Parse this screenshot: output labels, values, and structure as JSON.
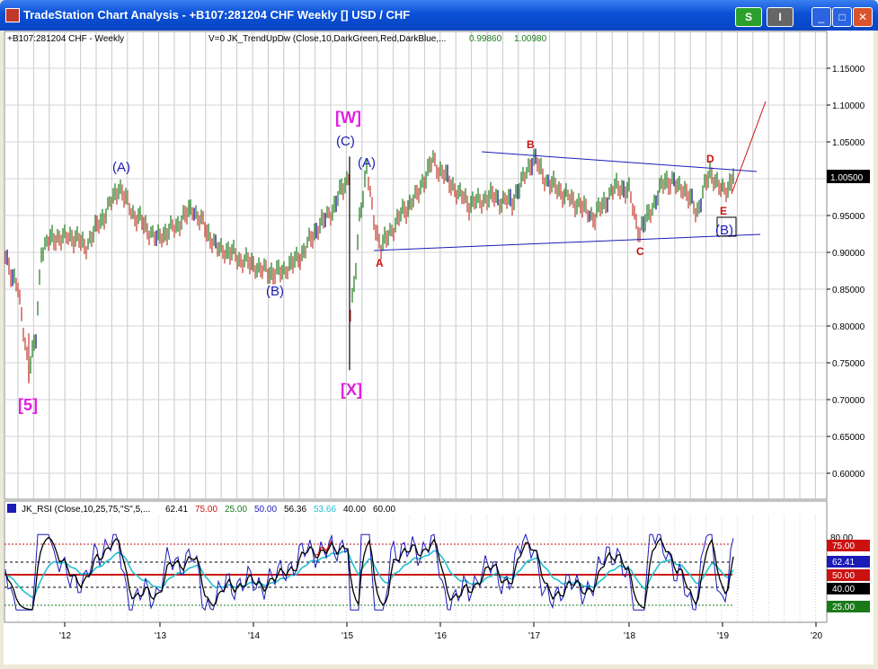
{
  "window": {
    "title": "TradeStation Chart Analysis - +B107:281204 CHF Weekly [] USD / CHF",
    "s_button": "S",
    "i_button": "I",
    "minimize": "_",
    "maximize": "□",
    "close": "✕"
  },
  "price_pane": {
    "symbol_label": "+B107:281204 CHF - Weekly",
    "indicator_label": "V=0   JK_TrendUpDw (Close,10,DarkGreen,Red,DarkBlue,...",
    "indicator_val1": "0.99860",
    "indicator_val2": "1.00980",
    "current_price": "1.00500",
    "y_ticks": [
      "1.15000",
      "1.10000",
      "1.05000",
      "1.00000",
      "0.95000",
      "0.90000",
      "0.85000",
      "0.80000",
      "0.75000",
      "0.70000",
      "0.65000",
      "0.60000"
    ],
    "wave_labels": {
      "five": "[5]",
      "w": "[W]",
      "x": "[X]",
      "a1": "(A)",
      "b1": "(B)",
      "c1": "(C)",
      "a2": "(A)",
      "b2": "(B)",
      "small_a": "A",
      "small_b": "B",
      "small_c": "C",
      "small_d": "D",
      "small_e": "E"
    }
  },
  "rsi_pane": {
    "label": "JK_RSI (Close,10,25,75,\"S\",5,...",
    "v1": "62.41",
    "v2": "75.00",
    "v3": "25.00",
    "v4": "50.00",
    "v5": "56.36",
    "v6": "53.66",
    "v7": "40.00",
    "v8": "60.00",
    "y_ticks": [
      "80.00"
    ],
    "right_boxes": {
      "b75": "75.00",
      "b62": "62.41",
      "b50": "50.00",
      "b40": "40.00",
      "b25": "25.00"
    }
  },
  "x_axis": {
    "ticks": [
      "'12",
      "'13",
      "'14",
      "'15",
      "'16",
      "'17",
      "'18",
      "'19",
      "'20"
    ]
  },
  "colors": {
    "up_bar": "#1a7a1a",
    "down_bar": "#c0392b",
    "neutral_bar": "#000080",
    "blue_label": "#1b1bb8",
    "magenta_label": "#e020e0",
    "red_label": "#cc1111"
  }
}
